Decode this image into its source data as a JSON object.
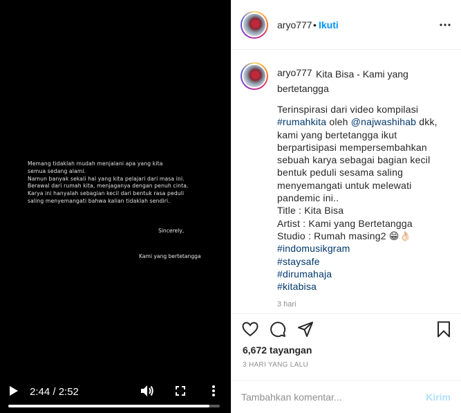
{
  "video": {
    "lines": [
      "Memang tidaklah mudah menjalani apa yang kita",
      "semua sedang alami.",
      "Namun banyak sekali hal yang kita pelajari dari masa ini.",
      "Berawal dari rumah kita, menjaganya dengan penuh cinta.",
      "Karya ini hanyalah sebagian kecil dari bentuk rasa peduli",
      "saling menyemangati bahwa kalian tidaklah sendiri."
    ],
    "sincerely": "Sincerely,",
    "signoff": "Kami yang bertetangga",
    "time": "2:44 / 2:52",
    "progress": 0.952
  },
  "header": {
    "username": "aryo777",
    "dot": "•",
    "follow": "Ikuti"
  },
  "caption": {
    "username": "aryo777",
    "title": "Kita Bisa - Kami yang bertetangga",
    "body": {
      "l1": "Terinspirasi dari video kompilasi",
      "l2_tag": "#rumahkita",
      "l2_mid": " oleh ",
      "l2_mention": "@najwashihab",
      "l2_end": " dkk,",
      "l3": "kami yang bertetangga ikut",
      "l4": "berpartisipasi mempersembahkan",
      "l5": "sebuah karya sebagai bagian kecil",
      "l6": "bentuk peduli sesama saling",
      "l7": "menyemangati untuk melewati",
      "l8": "pandemic ini..",
      "l9": "Title : Kita Bisa",
      "l10": "Artist : Kami yang Bertetangga",
      "l11": "Studio : Rumah masing2 😁👌🏻",
      "tags": [
        "#indomusikgram",
        "#staysafe",
        "#dirumahaja",
        "#kitabisa"
      ]
    },
    "date": "3 hari"
  },
  "stats": {
    "views": "6,672 tayangan",
    "ago": "3 HARI YANG LALU"
  },
  "comment": {
    "placeholder": "Tambahkan komentar...",
    "send": "Kirim"
  },
  "icons": {
    "play": "play-icon",
    "volume": "volume-icon",
    "fullscreen": "fullscreen-icon",
    "more": "more-vertical-icon",
    "heart": "heart-icon",
    "comment": "comment-icon",
    "share": "share-icon",
    "save": "bookmark-icon"
  }
}
